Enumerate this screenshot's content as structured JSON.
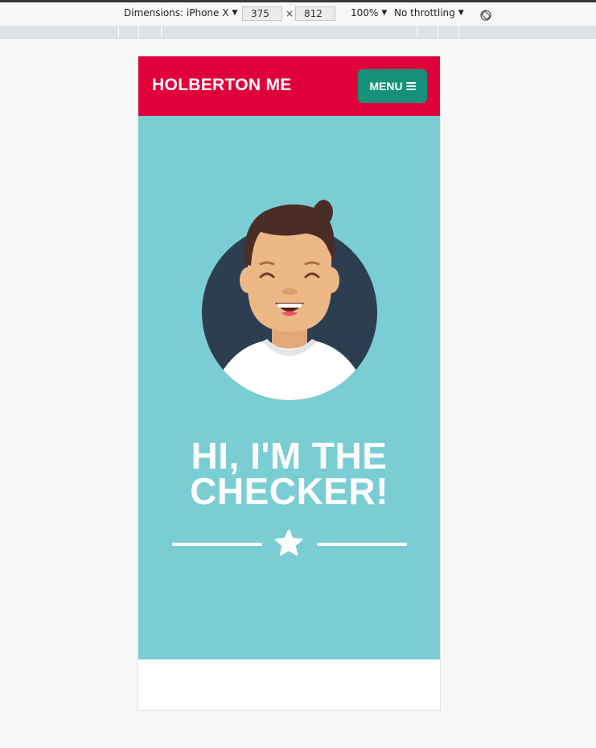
{
  "devtools": {
    "dimensions_label": "Dimensions: iPhone X",
    "width_value": "375",
    "times_sign": "×",
    "height_value": "812",
    "zoom": "100%",
    "throttling": "No throttling",
    "rotate_icon": "rotate-icon"
  },
  "site": {
    "brand": "HOLBERTON ME",
    "menu_label": "MENU",
    "menu_icon": "hamburger-icon",
    "hero_title_line1": "HI, I'M THE",
    "hero_title_line2": "CHECKER!",
    "divider_icon": "star-icon"
  },
  "colors": {
    "header": "#e0003a",
    "menu_button": "#149178",
    "hero_background": "#7acdd3",
    "avatar_circle": "#2c3e50",
    "text": "#ffffff"
  }
}
